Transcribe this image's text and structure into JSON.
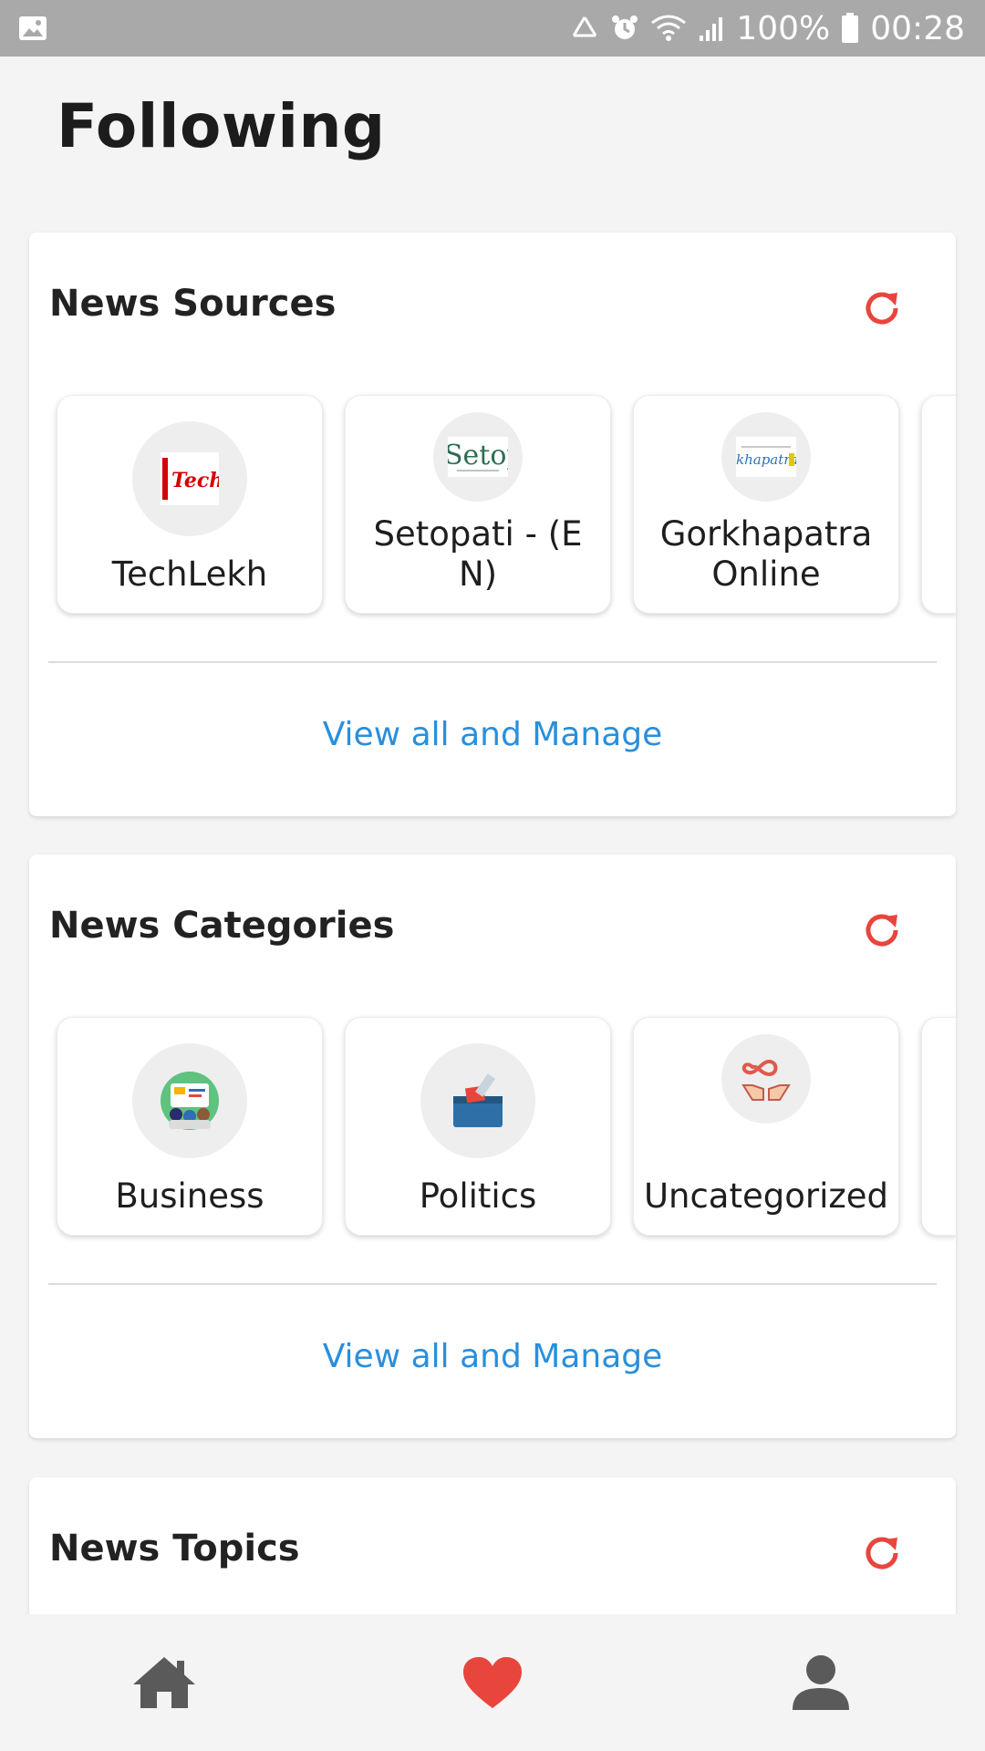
{
  "status_bar": {
    "battery": "100%",
    "time": "00:28",
    "icons": [
      "gallery-icon",
      "recycle-icon",
      "alarm-icon",
      "wifi-icon",
      "signal-icon",
      "battery-icon"
    ]
  },
  "page": {
    "title": "Following"
  },
  "sections": [
    {
      "title": "News Sources",
      "items": [
        {
          "label": "TechLekh",
          "logo_text": "Techl",
          "logo_color": "#d40000"
        },
        {
          "label": "Setopati - (EN)",
          "logo_text": "Setop",
          "logo_color": "#2e6e53"
        },
        {
          "label": "Gorkhapatra Online",
          "logo_text": "khapatra",
          "logo_color": "#2b74b8"
        }
      ],
      "link": "View all and Manage"
    },
    {
      "title": "News Categories",
      "items": [
        {
          "label": "Business",
          "icon": "business-icon"
        },
        {
          "label": "Politics",
          "icon": "ballot-box-icon"
        },
        {
          "label": "Uncategorized",
          "icon": "infinity-hands-icon"
        }
      ],
      "link": "View all and Manage"
    },
    {
      "title": "News Topics"
    }
  ],
  "bottom_nav": {
    "items": [
      {
        "name": "home",
        "icon": "home-icon"
      },
      {
        "name": "following",
        "icon": "heart-icon",
        "active": true
      },
      {
        "name": "profile",
        "icon": "person-icon"
      }
    ]
  },
  "colors": {
    "accent_red": "#e8453c",
    "link_blue": "#2a8fdc",
    "status_bar": "#a9a9a9"
  }
}
